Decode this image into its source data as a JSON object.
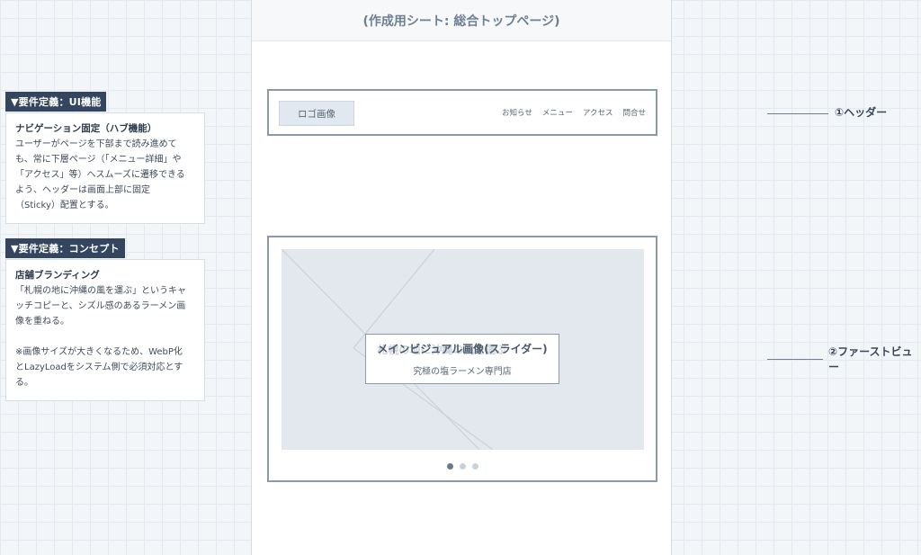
{
  "requirements": [
    {
      "tag": "▼要件定義：UI機能",
      "title": "ナビゲーション固定（ハブ機能）",
      "lines": [
        "ユーザーがページを下部まで読み進めて",
        "も、常に下層ページ（「メニュー詳細」や",
        "「アクセス」等）へスムーズに遷移できる",
        "よう、ヘッダーは画面上部に固定",
        "（Sticky）配置とする。"
      ]
    },
    {
      "tag": "▼要件定義：コンセプト",
      "title": "店舗ブランディング",
      "lines": [
        "「札幌の地に沖縄の風を運ぶ」というキャ",
        "ッチコピーと、シズル感のあるラーメン画",
        "像を重ねる。"
      ],
      "note_lines": [
        "※画像サイズが大きくなるため、WebP化",
        "とLazyLoadをシステム側で必須対応とす",
        "る。"
      ]
    }
  ],
  "sheet": {
    "title": "(作成用シート: 総合トップページ)",
    "header": {
      "logo": "ロゴ画像",
      "nav": [
        "お知らせ",
        "メニュー",
        "アクセス",
        "問合せ"
      ]
    },
    "first_view": {
      "title": "メインビジュアル画像(スライダー)",
      "ghost_text": "札幌の地に沖縄の風を運ぶ",
      "subtitle": "究極の塩ラーメン専門店",
      "dots": 3,
      "active_dot": 0
    }
  },
  "annotations": [
    {
      "label": "①ヘッダー"
    },
    {
      "label_lines": [
        "②ファーストビュ",
        "ー"
      ]
    }
  ]
}
